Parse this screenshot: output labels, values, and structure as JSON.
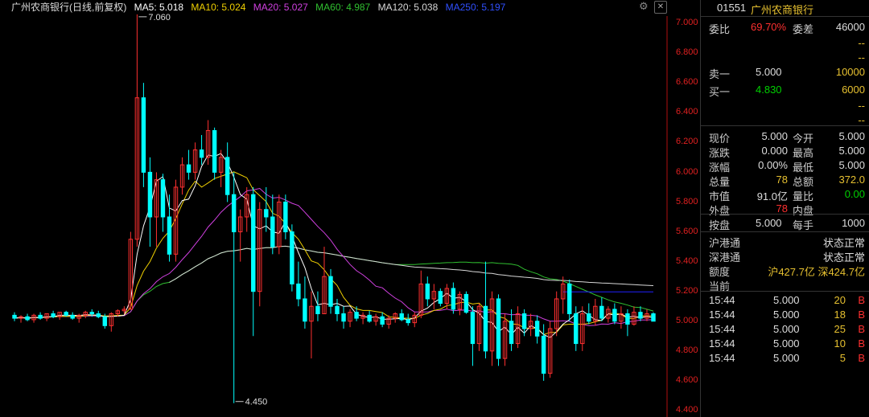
{
  "header": {
    "title": "广州农商银行(日线,前复权)",
    "ma5": "MA5: 5.018",
    "ma10": "MA10: 5.024",
    "ma20": "MA20: 5.027",
    "ma60": "MA60: 4.987",
    "ma120": "MA120: 5.038",
    "ma250": "MA250: 5.197"
  },
  "colors": {
    "up": "#ff3030",
    "down": "#00ffff",
    "ma5": "#ffffff",
    "ma10": "#f0d000",
    "ma20": "#d040e0",
    "ma60": "#30c030",
    "ma120": "#d8d8d8",
    "ma250": "#2020ff"
  },
  "icons": {
    "settings": "gear-icon",
    "close": "close-icon"
  },
  "chart_data": {
    "type": "candlestick",
    "ylim": [
      4.4,
      7.0
    ],
    "y_ticks": [
      "7.000",
      "6.800",
      "6.600",
      "6.400",
      "6.200",
      "6.000",
      "5.800",
      "5.600",
      "5.400",
      "5.200",
      "5.000",
      "4.800",
      "4.600",
      "4.400"
    ],
    "annotations": {
      "high": "7.060",
      "low": "4.450"
    },
    "candles": [
      [
        5.04,
        5.06,
        5.0,
        5.02
      ],
      [
        5.02,
        5.04,
        4.99,
        5.03
      ],
      [
        5.03,
        5.05,
        5.0,
        5.01
      ],
      [
        5.01,
        5.05,
        4.99,
        5.04
      ],
      [
        5.04,
        5.06,
        5.01,
        5.02
      ],
      [
        5.02,
        5.05,
        5.0,
        5.05
      ],
      [
        5.05,
        5.07,
        5.02,
        5.03
      ],
      [
        5.03,
        5.06,
        5.01,
        5.06
      ],
      [
        5.06,
        5.07,
        5.03,
        5.04
      ],
      [
        5.04,
        5.06,
        5.01,
        5.02
      ],
      [
        5.02,
        5.05,
        4.99,
        5.04
      ],
      [
        5.04,
        5.07,
        5.02,
        5.06
      ],
      [
        5.06,
        5.08,
        5.03,
        5.05
      ],
      [
        5.05,
        5.07,
        5.02,
        5.03
      ],
      [
        5.03,
        5.05,
        4.95,
        4.97
      ],
      [
        4.97,
        5.06,
        4.93,
        5.05
      ],
      [
        5.05,
        5.08,
        5.03,
        5.07
      ],
      [
        5.07,
        5.1,
        5.05,
        5.08
      ],
      [
        5.08,
        5.6,
        5.08,
        5.55
      ],
      [
        5.55,
        7.06,
        5.5,
        6.5
      ],
      [
        6.5,
        6.6,
        5.9,
        6.0
      ],
      [
        6.0,
        6.1,
        5.5,
        5.7
      ],
      [
        5.7,
        6.0,
        5.5,
        5.95
      ],
      [
        5.95,
        5.99,
        5.6,
        5.7
      ],
      [
        5.7,
        5.85,
        5.4,
        5.45
      ],
      [
        5.45,
        5.95,
        5.4,
        5.9
      ],
      [
        5.9,
        6.1,
        5.85,
        6.05
      ],
      [
        6.05,
        6.15,
        5.95,
        6.0
      ],
      [
        6.0,
        6.2,
        5.95,
        6.15
      ],
      [
        6.15,
        6.25,
        6.05,
        6.1
      ],
      [
        6.1,
        6.35,
        6.05,
        6.28
      ],
      [
        6.28,
        6.3,
        5.95,
        6.0
      ],
      [
        6.0,
        6.15,
        5.9,
        6.1
      ],
      [
        6.1,
        6.2,
        5.8,
        5.85
      ],
      [
        5.85,
        6.0,
        4.45,
        5.6
      ],
      [
        5.6,
        5.75,
        5.4,
        5.7
      ],
      [
        5.7,
        5.9,
        5.6,
        5.85
      ],
      [
        5.85,
        5.9,
        4.9,
        5.2
      ],
      [
        5.2,
        5.8,
        5.1,
        5.75
      ],
      [
        5.75,
        5.9,
        5.6,
        5.7
      ],
      [
        5.7,
        5.85,
        5.45,
        5.5
      ],
      [
        5.5,
        5.85,
        5.45,
        5.8
      ],
      [
        5.8,
        5.85,
        5.55,
        5.6
      ],
      [
        5.6,
        5.65,
        5.2,
        5.25
      ],
      [
        5.25,
        5.4,
        5.1,
        5.15
      ],
      [
        5.15,
        5.3,
        4.95,
        5.0
      ],
      [
        5.0,
        5.2,
        4.75,
        5.1
      ],
      [
        5.1,
        5.2,
        5.0,
        5.05
      ],
      [
        5.05,
        5.5,
        5.05,
        5.3
      ],
      [
        5.3,
        5.35,
        5.05,
        5.1
      ],
      [
        5.1,
        5.15,
        5.0,
        5.05
      ],
      [
        5.05,
        5.1,
        4.95,
        5.0
      ],
      [
        5.0,
        5.08,
        4.96,
        5.06
      ],
      [
        5.06,
        5.1,
        5.0,
        5.02
      ],
      [
        5.02,
        5.06,
        4.98,
        5.04
      ],
      [
        5.04,
        5.07,
        4.99,
        5.0
      ],
      [
        5.0,
        5.05,
        4.97,
        5.03
      ],
      [
        5.03,
        5.06,
        4.96,
        4.98
      ],
      [
        4.98,
        5.04,
        4.95,
        5.02
      ],
      [
        5.02,
        5.06,
        4.99,
        5.05
      ],
      [
        5.05,
        5.08,
        5.0,
        5.01
      ],
      [
        5.01,
        5.05,
        4.97,
        4.99
      ],
      [
        4.99,
        5.06,
        4.96,
        5.04
      ],
      [
        5.04,
        5.34,
        5.02,
        5.25
      ],
      [
        5.25,
        5.3,
        5.1,
        5.15
      ],
      [
        5.15,
        5.25,
        5.08,
        5.2
      ],
      [
        5.2,
        5.22,
        5.1,
        5.12
      ],
      [
        5.12,
        5.25,
        5.08,
        5.22
      ],
      [
        5.22,
        5.26,
        5.05,
        5.08
      ],
      [
        5.08,
        5.2,
        5.04,
        5.18
      ],
      [
        5.18,
        5.2,
        5.05,
        5.06
      ],
      [
        5.06,
        5.1,
        4.7,
        4.85
      ],
      [
        4.85,
        5.12,
        4.8,
        5.1
      ],
      [
        5.1,
        5.4,
        4.75,
        4.8
      ],
      [
        4.8,
        5.2,
        4.7,
        5.15
      ],
      [
        5.15,
        5.18,
        4.7,
        4.75
      ],
      [
        4.75,
        5.05,
        4.7,
        5.0
      ],
      [
        5.0,
        5.08,
        4.8,
        4.85
      ],
      [
        4.85,
        5.1,
        4.82,
        5.05
      ],
      [
        5.05,
        5.08,
        4.9,
        4.95
      ],
      [
        4.95,
        5.05,
        4.9,
        5.0
      ],
      [
        5.0,
        5.04,
        4.85,
        4.9
      ],
      [
        4.9,
        4.98,
        4.6,
        4.65
      ],
      [
        4.65,
        5.0,
        4.62,
        4.95
      ],
      [
        4.95,
        5.2,
        4.9,
        5.15
      ],
      [
        5.15,
        5.3,
        5.05,
        5.25
      ],
      [
        5.25,
        5.28,
        5.0,
        5.05
      ],
      [
        5.05,
        5.1,
        4.8,
        4.85
      ],
      [
        4.85,
        5.1,
        4.8,
        5.05
      ],
      [
        5.05,
        5.12,
        4.98,
        5.0
      ],
      [
        5.0,
        5.15,
        4.97,
        5.1
      ],
      [
        5.1,
        5.16,
        5.0,
        5.02
      ],
      [
        5.02,
        5.1,
        4.99,
        5.08
      ],
      [
        5.08,
        5.12,
        4.98,
        5.0
      ],
      [
        5.0,
        5.1,
        4.95,
        5.05
      ],
      [
        5.05,
        5.08,
        4.9,
        4.98
      ],
      [
        4.98,
        5.1,
        4.97,
        5.06
      ],
      [
        5.06,
        5.1,
        5.0,
        5.02
      ],
      [
        5.02,
        5.08,
        5.0,
        5.05
      ],
      [
        5.05,
        5.06,
        5.0,
        5.0
      ]
    ]
  },
  "panel": {
    "code": "01551",
    "name": "广州农商银行",
    "weibi_label": "委比",
    "weibi_value": "69.70%",
    "weicha_label": "委差",
    "weicha_value": "46000",
    "dash": "--",
    "sell1_label": "卖一",
    "sell1_price": "5.000",
    "sell1_vol": "10000",
    "buy1_label": "买一",
    "buy1_price": "4.830",
    "buy1_vol": "6000",
    "quote": [
      {
        "l1": "现价",
        "v1": "5.000",
        "l2": "今开",
        "v2": "5.000",
        "c1": "wht",
        "c2": "wht"
      },
      {
        "l1": "涨跌",
        "v1": "0.000",
        "l2": "最高",
        "v2": "5.000",
        "c1": "wht",
        "c2": "wht"
      },
      {
        "l1": "涨幅",
        "v1": "0.00%",
        "l2": "最低",
        "v2": "5.000",
        "c1": "wht",
        "c2": "wht"
      },
      {
        "l1": "总量",
        "v1": "78",
        "l2": "总额",
        "v2": "372.0",
        "c1": "yel",
        "c2": "yel"
      },
      {
        "l1": "市值",
        "v1": "91.0亿",
        "l2": "量比",
        "v2": "0.00",
        "c1": "wht",
        "c2": "green"
      },
      {
        "l1": "外盘",
        "v1": "78",
        "l2": "内盘",
        "v2": "",
        "c1": "red",
        "c2": "wht"
      }
    ],
    "anpan_label": "按盘",
    "anpan_value": "5.000",
    "meishou_label": "每手",
    "meishou_value": "1000",
    "hgt_label": "沪港通",
    "hgt_value": "状态正常",
    "sgt_label": "深港通",
    "sgt_value": "状态正常",
    "quota_label": "额度",
    "quota_value": "沪427.7亿 深424.7亿",
    "current_label": "当前",
    "ticks": [
      {
        "time": "15:44",
        "price": "5.000",
        "vol": "20",
        "side": "B"
      },
      {
        "time": "15:44",
        "price": "5.000",
        "vol": "18",
        "side": "B"
      },
      {
        "time": "15:44",
        "price": "5.000",
        "vol": "25",
        "side": "B"
      },
      {
        "time": "15:44",
        "price": "5.000",
        "vol": "10",
        "side": "B"
      },
      {
        "time": "15:44",
        "price": "5.000",
        "vol": "5",
        "side": "B"
      }
    ]
  }
}
